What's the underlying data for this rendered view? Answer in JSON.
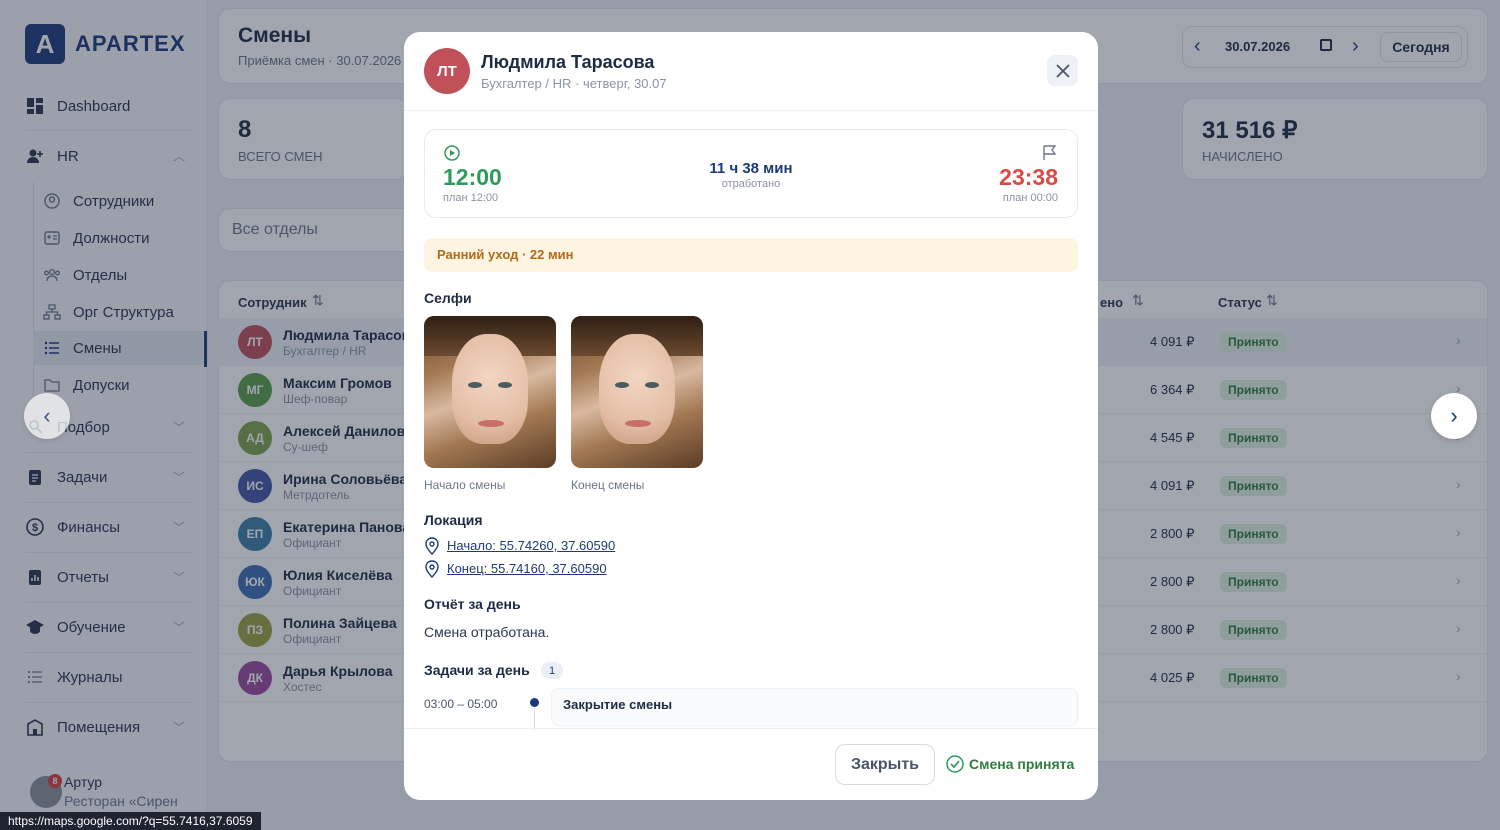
{
  "app": {
    "logo_letter": "A",
    "logo_text": "APARTEX"
  },
  "sidebar": {
    "dashboard": "Dashboard",
    "hr": "HR",
    "hr_items": [
      "Сотрудники",
      "Должности",
      "Отделы",
      "Орг Структура",
      "Смены",
      "Допуски"
    ],
    "groups": [
      "Подбор",
      "Задачи",
      "Финансы",
      "Отчеты",
      "Обучение",
      "Журналы",
      "Помещения"
    ],
    "user": {
      "name": "Артур",
      "org": "Ресторан «Сирен",
      "notif": "8"
    }
  },
  "header": {
    "title": "Смены",
    "subtitle": "Приёмка смен · 30.07.2026",
    "date": "30.07.2026",
    "today_label": "Сегодня"
  },
  "stats": {
    "total_value": "8",
    "total_label": "ВСЕГО СМЕН",
    "accrued_value": "31 516 ₽",
    "accrued_label": "НАЧИСЛЕНО"
  },
  "filter": {
    "dept_placeholder": "Все отделы"
  },
  "table": {
    "col_employee": "Сотрудник",
    "col_accrued": "ено",
    "col_status": "Статус",
    "rows": [
      {
        "initials": "ЛТ",
        "name": "Людмила Тарасова",
        "role": "Бухгалтер / HR",
        "amount": "4 091 ₽",
        "status": "Принято",
        "color": "#c0505a"
      },
      {
        "initials": "МГ",
        "name": "Максим Громов",
        "role": "Шеф-повар",
        "amount": "6 364 ₽",
        "status": "Принято",
        "color": "#5a9e4b"
      },
      {
        "initials": "АД",
        "name": "Алексей Данилов",
        "role": "Су-шеф",
        "amount": "4 545 ₽",
        "status": "Принято",
        "color": "#7ea34a"
      },
      {
        "initials": "ИС",
        "name": "Ирина Соловьёва",
        "role": "Метрдотель",
        "amount": "4 091 ₽",
        "status": "Принято",
        "color": "#4257a8"
      },
      {
        "initials": "ЕП",
        "name": "Екатерина Панова",
        "role": "Официант",
        "amount": "2 800 ₽",
        "status": "Принято",
        "color": "#3d7fa6"
      },
      {
        "initials": "ЮК",
        "name": "Юлия Киселёва",
        "role": "Официант",
        "amount": "2 800 ₽",
        "status": "Принято",
        "color": "#3e6db5"
      },
      {
        "initials": "ПЗ",
        "name": "Полина Зайцева",
        "role": "Официант",
        "amount": "2 800 ₽",
        "status": "Принято",
        "color": "#9aa33e"
      },
      {
        "initials": "ДК",
        "name": "Дарья Крылова",
        "role": "Хостес",
        "amount": "4 025 ₽",
        "status": "Принято",
        "color": "#9b4a9e"
      }
    ]
  },
  "modal": {
    "initials": "ЛТ",
    "name": "Людмила Тарасова",
    "subtitle": "Бухгалтер / HR · четверг, 30.07",
    "start_time": "12:00",
    "start_plan": "план 12:00",
    "duration": "11 ч 38 мин",
    "duration_label": "отработано",
    "end_time": "23:38",
    "end_plan": "план 00:00",
    "warning": "Ранний уход · 22 мин",
    "selfie_title": "Селфи",
    "selfie_start": "Начало смены",
    "selfie_end": "Конец смены",
    "location_title": "Локация",
    "loc_start": "Начало: 55.74260, 37.60590",
    "loc_end": "Конец: 55.74160, 37.60590",
    "report_title": "Отчёт за день",
    "report_text": "Смена отработана.",
    "tasks_title": "Задачи за день",
    "tasks_count": "1",
    "task_time": "03:00 – 05:00",
    "task_name": "Закрытие смены",
    "close_label": "Закрыть",
    "accepted_label": "Смена принята"
  },
  "statusbar": {
    "url": "https://maps.google.com/?q=55.7416,37.6059"
  }
}
